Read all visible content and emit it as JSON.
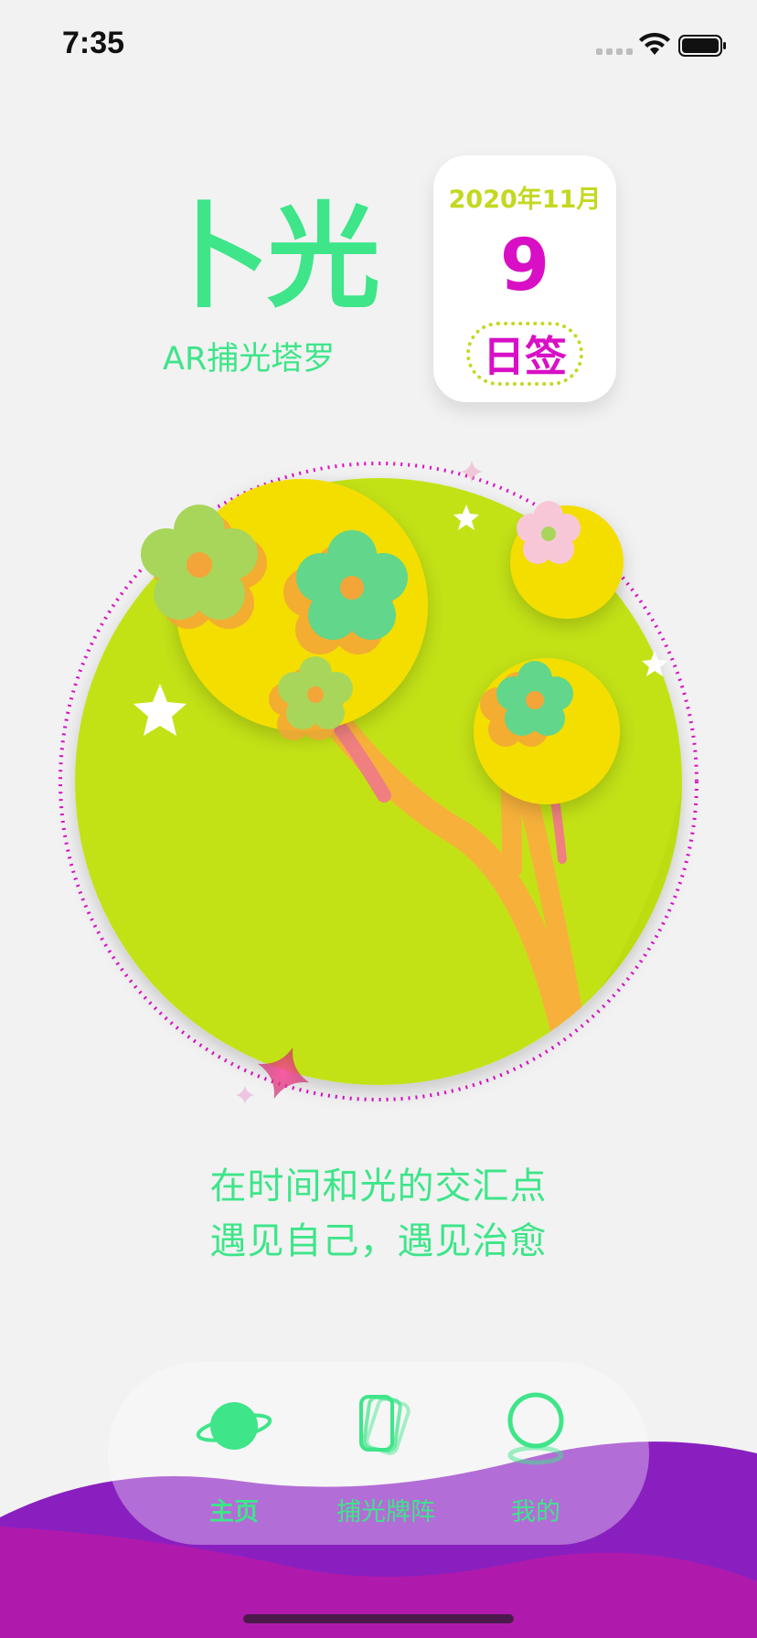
{
  "status_bar": {
    "time": "7:35"
  },
  "logo": {
    "title": "卜光",
    "subtitle": "AR捕光塔罗"
  },
  "calendar": {
    "month": "2020年11月",
    "day": "9",
    "sign_label": "日签"
  },
  "slogan": {
    "line1": "在时间和光的交汇点",
    "line2": "遇见自己，遇见治愈"
  },
  "tabs": [
    {
      "label": "主页",
      "icon": "planet-icon",
      "active": true
    },
    {
      "label": "捕光牌阵",
      "icon": "cards-icon",
      "active": false
    },
    {
      "label": "我的",
      "icon": "profile-ring-icon",
      "active": false
    }
  ],
  "colors": {
    "accent_green": "#3ee589",
    "lime": "#c3d820",
    "magenta": "#d90fc6",
    "yellow": "#f4de00",
    "wave_purple": "#8a1fc0",
    "wave_magenta": "#b01aac"
  }
}
